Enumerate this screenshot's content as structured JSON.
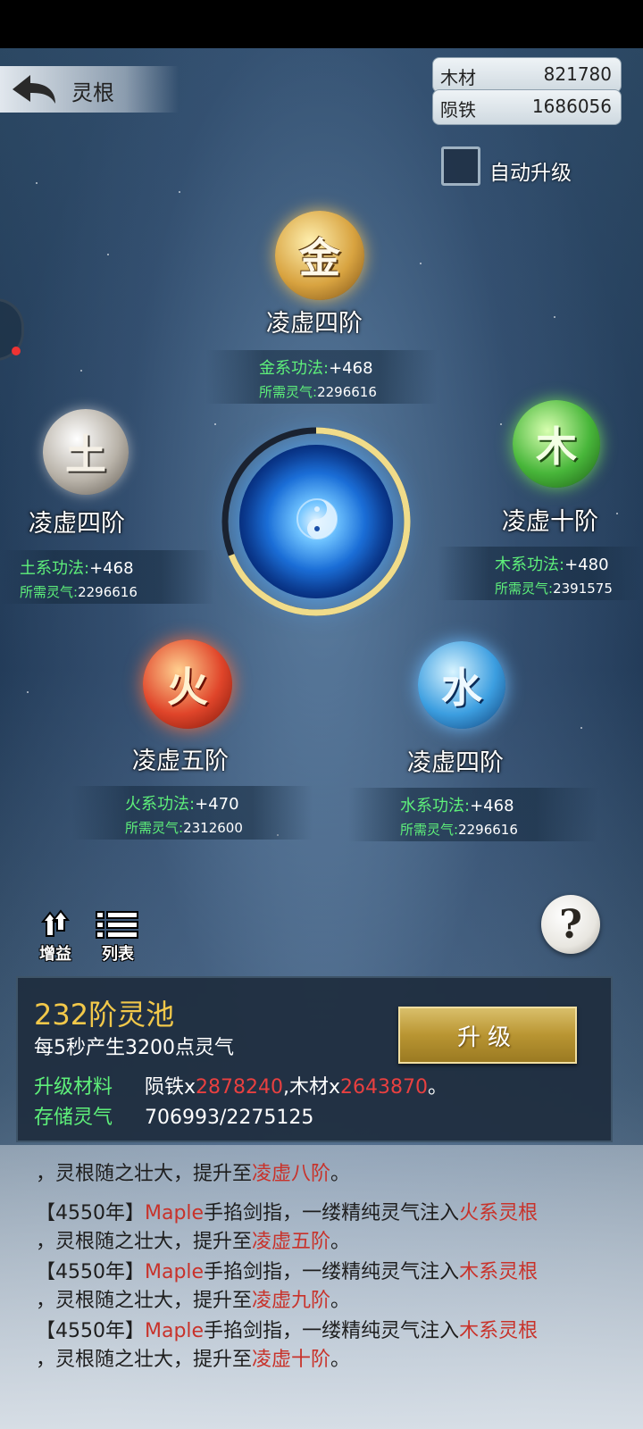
{
  "header": {
    "title": "灵根",
    "back_icon": "back-arrow-icon"
  },
  "resources": [
    {
      "label": "木材",
      "value": "821780"
    },
    {
      "label": "陨铁",
      "value": "1686056"
    }
  ],
  "auto_upgrade": {
    "label": "自动升级",
    "checked": false
  },
  "elements": {
    "gold": {
      "glyph": "金",
      "level": "凌虚四阶",
      "skill_label": "金系功法:",
      "skill_value": "+468",
      "req_label": "所需灵气:",
      "req_value": "2296616"
    },
    "earth": {
      "glyph": "土",
      "level": "凌虚四阶",
      "skill_label": "土系功法:",
      "skill_value": "+468",
      "req_label": "所需灵气:",
      "req_value": "2296616"
    },
    "wood": {
      "glyph": "木",
      "level": "凌虚十阶",
      "skill_label": "木系功法:",
      "skill_value": "+480",
      "req_label": "所需灵气:",
      "req_value": "2391575"
    },
    "fire": {
      "glyph": "火",
      "level": "凌虚五阶",
      "skill_label": "火系功法:",
      "skill_value": "+470",
      "req_label": "所需灵气:",
      "req_value": "2312600"
    },
    "water": {
      "glyph": "水",
      "level": "凌虚四阶",
      "skill_label": "水系功法:",
      "skill_value": "+468",
      "req_label": "所需灵气:",
      "req_value": "2296616"
    }
  },
  "core": {
    "progress_fraction": 0.31
  },
  "tools": {
    "buff_label": "增益",
    "list_label": "列表",
    "help_glyph": "?"
  },
  "pool": {
    "title": "232阶灵池",
    "desc": "每5秒产生3200点灵气",
    "upgrade_button": "升级",
    "materials_label": "升级材料",
    "mat1_name": "陨铁x",
    "mat1_value": "2878240",
    "mat_sep": ",木材x",
    "mat2_value": "2643870",
    "mat_end": "。",
    "storage_label": "存储灵气",
    "storage_value": "706993/2275125"
  },
  "log": {
    "partial_cont_a": "，灵根随之壮大，提升至",
    "partial_cont_b": "凌虚八阶",
    "partial_cont_c": "。",
    "entries": [
      {
        "year": "【4550年】",
        "name": "Maple",
        "mid": "手掐剑指，一缕精纯灵气注入",
        "root": "火系灵根",
        "cont": "，灵根随之壮大，提升至",
        "level": "凌虚五阶",
        "end": "。"
      },
      {
        "year": "【4550年】",
        "name": "Maple",
        "mid": "手掐剑指，一缕精纯灵气注入",
        "root": "木系灵根",
        "cont": "，灵根随之壮大，提升至",
        "level": "凌虚九阶",
        "end": "。"
      },
      {
        "year": "【4550年】",
        "name": "Maple",
        "mid": "手掐剑指，一缕精纯灵气注入",
        "root": "木系灵根",
        "cont": "，灵根随之壮大，提升至",
        "level": "凌虚十阶",
        "end": "。"
      }
    ]
  }
}
